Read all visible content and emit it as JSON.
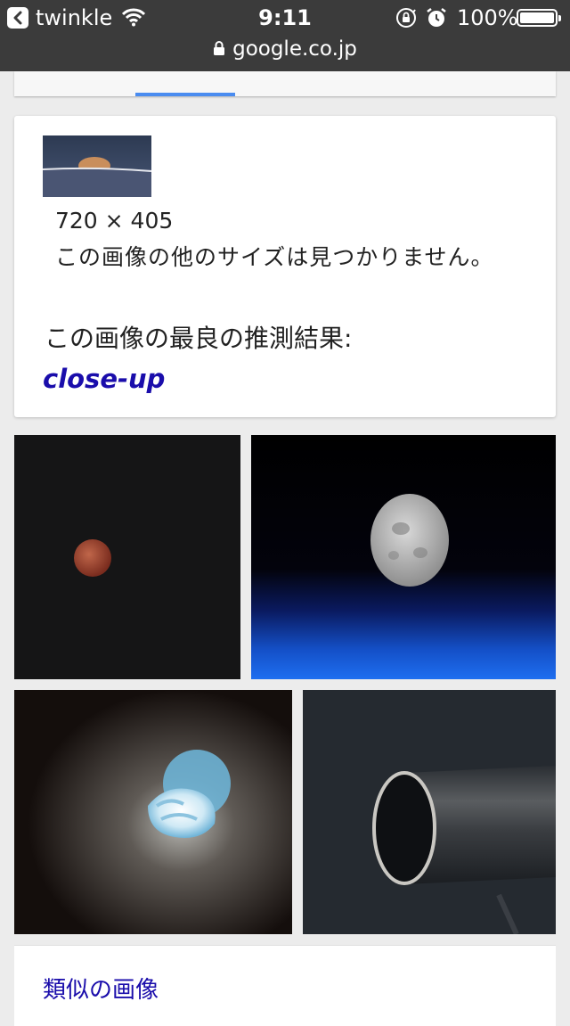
{
  "status_bar": {
    "app_name": "twinkle",
    "time": "9:11",
    "battery": "100%",
    "url": "google.co.jp",
    "icons": [
      "back-icon",
      "wifi-icon",
      "orientation-lock-icon",
      "alarm-icon",
      "battery-icon",
      "lock-icon"
    ]
  },
  "info": {
    "dimensions": "720 × 405",
    "no_other_sizes": "この画像の他のサイズは見つかりません。",
    "best_guess_label": "この画像の最良の推測結果:",
    "best_guess_value": "close-up"
  },
  "similar": {
    "label": "類似の画像"
  },
  "colors": {
    "status_bar_bg": "#3b3b3b",
    "tab_accent": "#4a8cf0",
    "link": "#1a0dab"
  }
}
